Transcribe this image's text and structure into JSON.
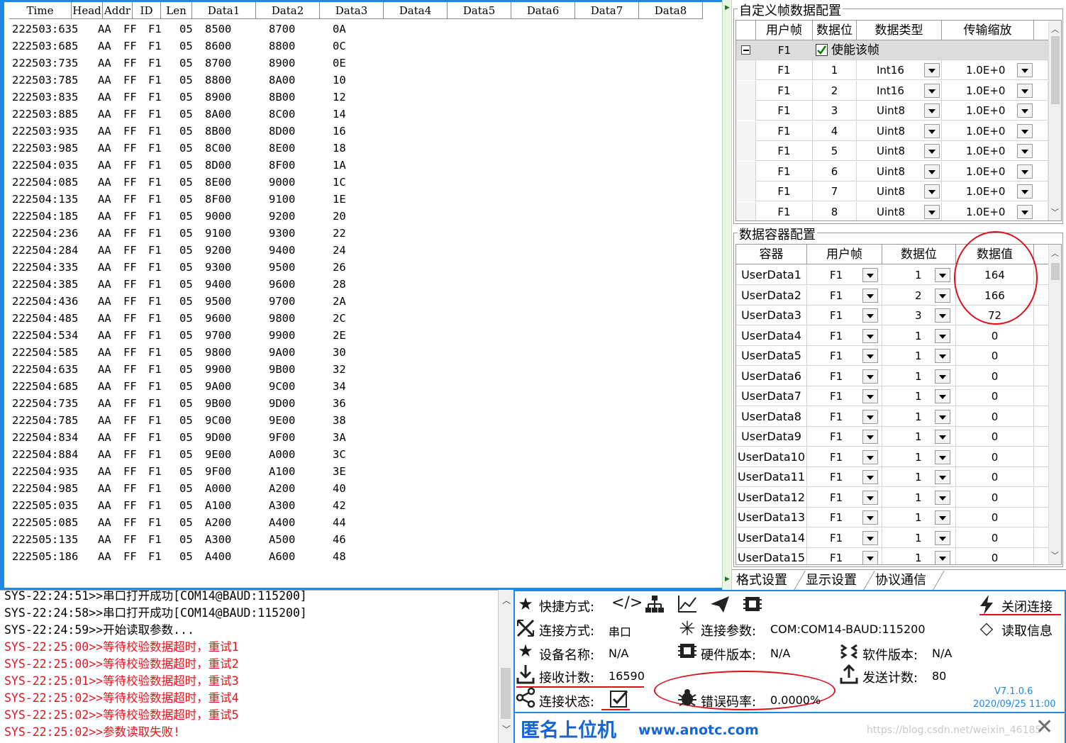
{
  "data_table": {
    "columns": [
      "Time",
      "Head",
      "Addr",
      "ID",
      "Len",
      "Data1",
      "Data2",
      "Data3",
      "Data4",
      "Data5",
      "Data6",
      "Data7",
      "Data8"
    ],
    "rows": [
      [
        "222503:635",
        "AA",
        "FF",
        "F1",
        "05",
        "8500",
        "8700",
        "0A"
      ],
      [
        "222503:685",
        "AA",
        "FF",
        "F1",
        "05",
        "8600",
        "8800",
        "0C"
      ],
      [
        "222503:735",
        "AA",
        "FF",
        "F1",
        "05",
        "8700",
        "8900",
        "0E"
      ],
      [
        "222503:785",
        "AA",
        "FF",
        "F1",
        "05",
        "8800",
        "8A00",
        "10"
      ],
      [
        "222503:835",
        "AA",
        "FF",
        "F1",
        "05",
        "8900",
        "8B00",
        "12"
      ],
      [
        "222503:885",
        "AA",
        "FF",
        "F1",
        "05",
        "8A00",
        "8C00",
        "14"
      ],
      [
        "222503:935",
        "AA",
        "FF",
        "F1",
        "05",
        "8B00",
        "8D00",
        "16"
      ],
      [
        "222503:985",
        "AA",
        "FF",
        "F1",
        "05",
        "8C00",
        "8E00",
        "18"
      ],
      [
        "222504:035",
        "AA",
        "FF",
        "F1",
        "05",
        "8D00",
        "8F00",
        "1A"
      ],
      [
        "222504:085",
        "AA",
        "FF",
        "F1",
        "05",
        "8E00",
        "9000",
        "1C"
      ],
      [
        "222504:135",
        "AA",
        "FF",
        "F1",
        "05",
        "8F00",
        "9100",
        "1E"
      ],
      [
        "222504:185",
        "AA",
        "FF",
        "F1",
        "05",
        "9000",
        "9200",
        "20"
      ],
      [
        "222504:236",
        "AA",
        "FF",
        "F1",
        "05",
        "9100",
        "9300",
        "22"
      ],
      [
        "222504:284",
        "AA",
        "FF",
        "F1",
        "05",
        "9200",
        "9400",
        "24"
      ],
      [
        "222504:335",
        "AA",
        "FF",
        "F1",
        "05",
        "9300",
        "9500",
        "26"
      ],
      [
        "222504:385",
        "AA",
        "FF",
        "F1",
        "05",
        "9400",
        "9600",
        "28"
      ],
      [
        "222504:436",
        "AA",
        "FF",
        "F1",
        "05",
        "9500",
        "9700",
        "2A"
      ],
      [
        "222504:485",
        "AA",
        "FF",
        "F1",
        "05",
        "9600",
        "9800",
        "2C"
      ],
      [
        "222504:534",
        "AA",
        "FF",
        "F1",
        "05",
        "9700",
        "9900",
        "2E"
      ],
      [
        "222504:585",
        "AA",
        "FF",
        "F1",
        "05",
        "9800",
        "9A00",
        "30"
      ],
      [
        "222504:635",
        "AA",
        "FF",
        "F1",
        "05",
        "9900",
        "9B00",
        "32"
      ],
      [
        "222504:685",
        "AA",
        "FF",
        "F1",
        "05",
        "9A00",
        "9C00",
        "34"
      ],
      [
        "222504:735",
        "AA",
        "FF",
        "F1",
        "05",
        "9B00",
        "9D00",
        "36"
      ],
      [
        "222504:785",
        "AA",
        "FF",
        "F1",
        "05",
        "9C00",
        "9E00",
        "38"
      ],
      [
        "222504:834",
        "AA",
        "FF",
        "F1",
        "05",
        "9D00",
        "9F00",
        "3A"
      ],
      [
        "222504:884",
        "AA",
        "FF",
        "F1",
        "05",
        "9E00",
        "A000",
        "3C"
      ],
      [
        "222504:935",
        "AA",
        "FF",
        "F1",
        "05",
        "9F00",
        "A100",
        "3E"
      ],
      [
        "222504:985",
        "AA",
        "FF",
        "F1",
        "05",
        "A000",
        "A200",
        "40"
      ],
      [
        "222505:035",
        "AA",
        "FF",
        "F1",
        "05",
        "A100",
        "A300",
        "42"
      ],
      [
        "222505:085",
        "AA",
        "FF",
        "F1",
        "05",
        "A200",
        "A400",
        "44"
      ],
      [
        "222505:135",
        "AA",
        "FF",
        "F1",
        "05",
        "A300",
        "A500",
        "46"
      ],
      [
        "222505:186",
        "AA",
        "FF",
        "F1",
        "05",
        "A400",
        "A600",
        "48"
      ]
    ]
  },
  "frame_config": {
    "title": "自定义帧数据配置",
    "headers": [
      "用户帧",
      "数据位",
      "数据类型",
      "传输缩放"
    ],
    "group_row": {
      "frame": "F1",
      "enable_label": "使能该帧",
      "enabled": true
    },
    "rows": [
      {
        "frame": "F1",
        "bit": "1",
        "type": "Int16",
        "scale": "1.0E+0"
      },
      {
        "frame": "F1",
        "bit": "2",
        "type": "Int16",
        "scale": "1.0E+0"
      },
      {
        "frame": "F1",
        "bit": "3",
        "type": "Uint8",
        "scale": "1.0E+0"
      },
      {
        "frame": "F1",
        "bit": "4",
        "type": "Uint8",
        "scale": "1.0E+0"
      },
      {
        "frame": "F1",
        "bit": "5",
        "type": "Uint8",
        "scale": "1.0E+0"
      },
      {
        "frame": "F1",
        "bit": "6",
        "type": "Uint8",
        "scale": "1.0E+0"
      },
      {
        "frame": "F1",
        "bit": "7",
        "type": "Uint8",
        "scale": "1.0E+0"
      },
      {
        "frame": "F1",
        "bit": "8",
        "type": "Uint8",
        "scale": "1.0E+0"
      }
    ]
  },
  "container_config": {
    "title": "数据容器配置",
    "headers": [
      "容器",
      "用户帧",
      "数据位",
      "数据值"
    ],
    "rows": [
      {
        "name": "UserData1",
        "frame": "F1",
        "bit": "1",
        "value": "164"
      },
      {
        "name": "UserData2",
        "frame": "F1",
        "bit": "2",
        "value": "166"
      },
      {
        "name": "UserData3",
        "frame": "F1",
        "bit": "3",
        "value": "72"
      },
      {
        "name": "UserData4",
        "frame": "F1",
        "bit": "1",
        "value": "0"
      },
      {
        "name": "UserData5",
        "frame": "F1",
        "bit": "1",
        "value": "0"
      },
      {
        "name": "UserData6",
        "frame": "F1",
        "bit": "1",
        "value": "0"
      },
      {
        "name": "UserData7",
        "frame": "F1",
        "bit": "1",
        "value": "0"
      },
      {
        "name": "UserData8",
        "frame": "F1",
        "bit": "1",
        "value": "0"
      },
      {
        "name": "UserData9",
        "frame": "F1",
        "bit": "1",
        "value": "0"
      },
      {
        "name": "UserData10",
        "frame": "F1",
        "bit": "1",
        "value": "0"
      },
      {
        "name": "UserData11",
        "frame": "F1",
        "bit": "1",
        "value": "0"
      },
      {
        "name": "UserData12",
        "frame": "F1",
        "bit": "1",
        "value": "0"
      },
      {
        "name": "UserData13",
        "frame": "F1",
        "bit": "1",
        "value": "0"
      },
      {
        "name": "UserData14",
        "frame": "F1",
        "bit": "1",
        "value": "0"
      },
      {
        "name": "UserData15",
        "frame": "F1",
        "bit": "1",
        "value": "0"
      }
    ]
  },
  "tabs": [
    "格式设置",
    "显示设置",
    "协议通信"
  ],
  "log": {
    "lines": [
      {
        "text": "SYS-22:24:51>>串口打开成功[COM14@BAUD:115200]",
        "color": "#000000"
      },
      {
        "text": "SYS-22:24:58>>串口打开成功[COM14@BAUD:115200]",
        "color": "#000000"
      },
      {
        "text": "SYS-22:24:59>>开始读取参数...",
        "color": "#000000"
      },
      {
        "text": "SYS-22:25:00>>等待校验数据超时，重试1",
        "color": "#e8141c"
      },
      {
        "text": "SYS-22:25:00>>等待校验数据超时，重试2",
        "color": "#e8141c"
      },
      {
        "text": "SYS-22:25:01>>等待校验数据超时，重试3",
        "color": "#e8141c"
      },
      {
        "text": "SYS-22:25:02>>等待校验数据超时，重试4",
        "color": "#e8141c"
      },
      {
        "text": "SYS-22:25:02>>等待校验数据超时，重试5",
        "color": "#e8141c"
      },
      {
        "text": "SYS-22:25:02>>参数读取失败!",
        "color": "#e8141c"
      }
    ]
  },
  "status": {
    "shortcut_label": "快捷方式:",
    "close_connection": "关闭连接",
    "read_info": "读取信息",
    "conn_mode_label": "连接方式:",
    "conn_mode_value": "串口",
    "conn_param_label": "连接参数:",
    "conn_param_value": "COM:COM14-BAUD:115200",
    "device_label": "设备名称:",
    "device_value": "N/A",
    "hw_label": "硬件版本:",
    "hw_value": "N/A",
    "sw_label": "软件版本:",
    "sw_value": "N/A",
    "recv_label": "接收计数:",
    "recv_value": "16590",
    "send_label": "发送计数:",
    "send_value": "80",
    "conn_state_label": "连接状态:",
    "error_label": "错误码率:",
    "error_value": "0.0000%",
    "version": "V7.1.0.6",
    "build_date": "2020/09/25 11:00",
    "brand": "匿名上位机",
    "website": "www.anotc.com",
    "watermark": "https://blog.csdn.net/weixin_46185"
  },
  "colors": {
    "accent": "#1e88e5",
    "error": "#e8141c",
    "brand": "#1565d8"
  }
}
